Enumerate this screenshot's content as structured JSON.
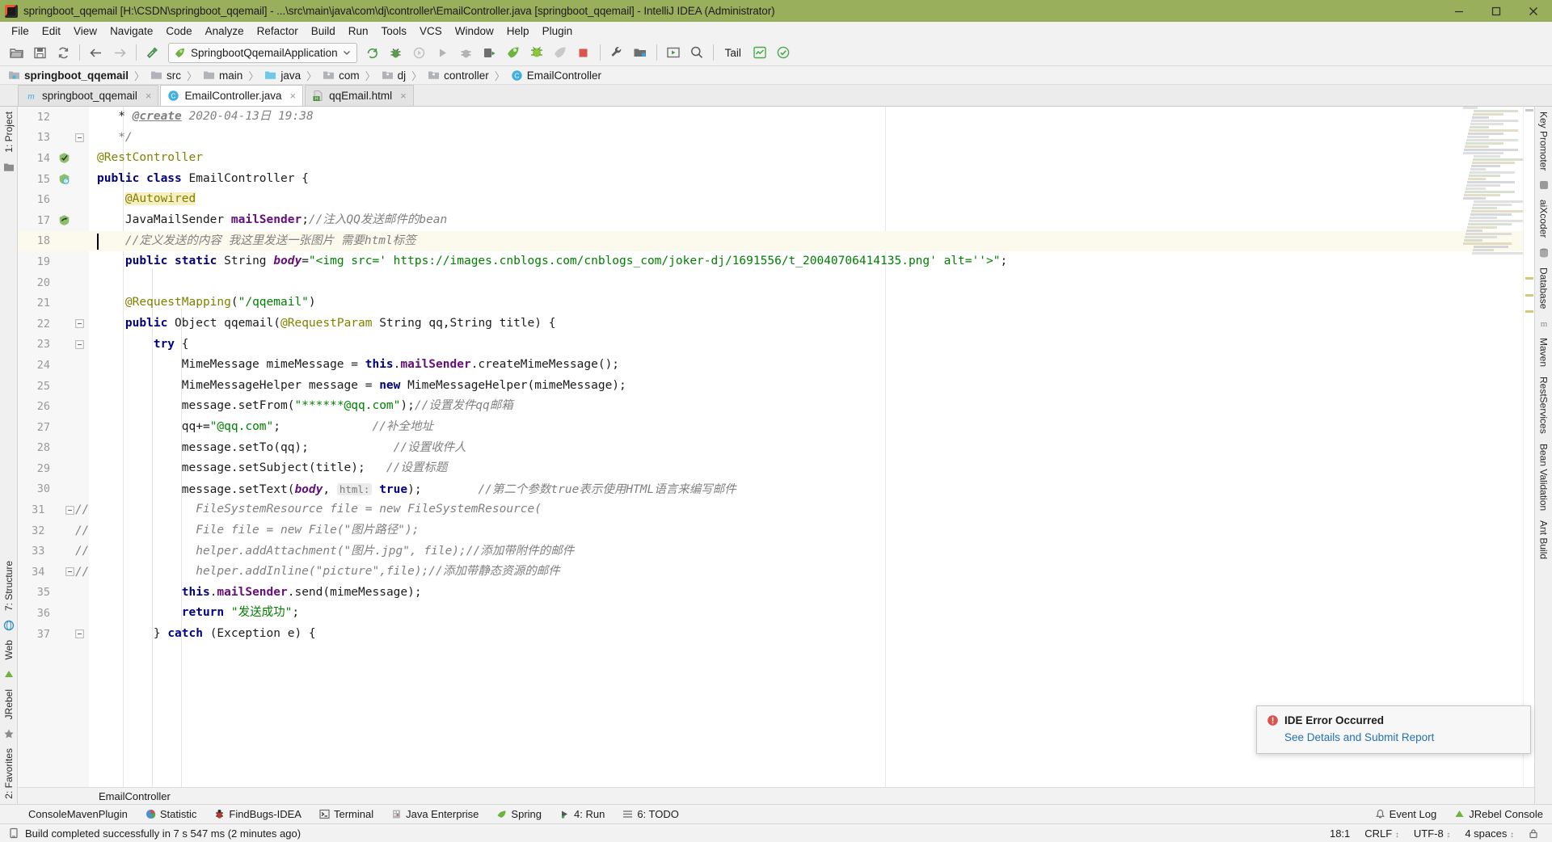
{
  "window": {
    "title": "springboot_qqemail [H:\\CSDN\\springboot_qqemail] - ...\\src\\main\\java\\com\\dj\\controller\\EmailController.java [springboot_qqemail] - IntelliJ IDEA (Administrator)",
    "icon": "intellij-idea-icon",
    "titlebar_color": "#9aaf5c",
    "minimize": "minimize-button",
    "maximize": "maximize-button",
    "close": "close-button"
  },
  "menubar": {
    "items": [
      {
        "label": "File"
      },
      {
        "label": "Edit"
      },
      {
        "label": "View"
      },
      {
        "label": "Navigate"
      },
      {
        "label": "Code"
      },
      {
        "label": "Analyze"
      },
      {
        "label": "Refactor"
      },
      {
        "label": "Build"
      },
      {
        "label": "Run"
      },
      {
        "label": "Tools"
      },
      {
        "label": "VCS"
      },
      {
        "label": "Window"
      },
      {
        "label": "Help"
      },
      {
        "label": "Plugin"
      }
    ]
  },
  "toolbar": {
    "run_config": "SpringbootQqemailApplication",
    "tail_label": "Tail",
    "icons": [
      "open-folder-icon",
      "save-all-icon",
      "sync-refresh-icon",
      "back-arrow-icon",
      "forward-arrow-icon",
      "build-hammer-icon",
      "rerun-icon",
      "debug-bug-icon",
      "run-with-coverage-icon",
      "run-icon",
      "attach-debugger-icon",
      "profile-icon",
      "spring-boot-run-icon",
      "spring-boot-debug-icon",
      "spring-boot-run-dashboard-icon",
      "stop-icon",
      "settings-wrench-icon",
      "project-structure-icon",
      "update-project-icon",
      "search-everywhere-icon",
      "tail-icon",
      "plugin-chart-icon",
      "check-circle-icon"
    ]
  },
  "breadcrumb": {
    "items": [
      {
        "label": "springboot_qqemail",
        "icon": "module-icon"
      },
      {
        "label": "src",
        "icon": "folder-icon"
      },
      {
        "label": "main",
        "icon": "folder-icon"
      },
      {
        "label": "java",
        "icon": "source-root-icon"
      },
      {
        "label": "com",
        "icon": "package-icon"
      },
      {
        "label": "dj",
        "icon": "package-icon"
      },
      {
        "label": "controller",
        "icon": "package-icon"
      },
      {
        "label": "EmailController",
        "icon": "class-icon"
      }
    ],
    "separator": "〉"
  },
  "tabs": [
    {
      "label": "springboot_qqemail",
      "icon": "maven-module-icon",
      "active": false,
      "close": "×"
    },
    {
      "label": "EmailController.java",
      "icon": "java-class-icon",
      "active": true,
      "close": "×"
    },
    {
      "label": "qqEmail.html",
      "icon": "html-file-icon",
      "active": false,
      "close": "×"
    }
  ],
  "left_strip": {
    "top": [
      {
        "label": "1: Project",
        "icon": "project-tool-icon"
      }
    ],
    "bottom": [
      {
        "label": "2: Favorites",
        "icon": "favorites-icon"
      },
      {
        "label": "JRebel",
        "icon": "jrebel-icon"
      },
      {
        "label": "Web",
        "icon": "web-icon"
      },
      {
        "label": "7: Structure",
        "icon": "structure-icon"
      }
    ]
  },
  "right_strip": {
    "items": [
      {
        "label": "Key Promoter",
        "icon": "key-promoter-icon"
      },
      {
        "label": "aiXcoder",
        "icon": "aixcoder-icon"
      },
      {
        "label": "Database",
        "icon": "database-icon"
      },
      {
        "label": "Maven",
        "icon": "maven-icon"
      },
      {
        "label": "RestServices",
        "icon": "rest-services-icon"
      },
      {
        "label": "Bean Validation",
        "icon": "bean-validation-icon"
      },
      {
        "label": "Ant Build",
        "icon": "ant-build-icon"
      }
    ]
  },
  "editor": {
    "first_line": 12,
    "caret_line": 18,
    "breadcrumb": "EmailController",
    "lines": [
      {
        "num": "12",
        "hl": false,
        "gutter_icon": "",
        "fold": "",
        "html": "   * <span class='cmt-u'>@create</span> <span class='cmt'>2020-04-13日 19:38</span>"
      },
      {
        "num": "13",
        "hl": false,
        "gutter_icon": "",
        "fold": "minus",
        "html": "   <span class='cmt'>*/</span>"
      },
      {
        "num": "14",
        "hl": false,
        "gutter_icon": "bean-check-icon",
        "fold": "",
        "html": "<span class='ann'>@RestController</span>"
      },
      {
        "num": "15",
        "hl": false,
        "gutter_icon": "spring-bean-icon",
        "fold": "",
        "html": "<span class='kw'>public class</span> EmailController {"
      },
      {
        "num": "16",
        "hl": false,
        "gutter_icon": "",
        "fold": "",
        "html": "    <span class='ann-hl'>@Autowired</span>"
      },
      {
        "num": "17",
        "hl": false,
        "gutter_icon": "autowired-icon",
        "fold": "",
        "html": "    JavaMailSender <span class='fldp'>mailSender</span>;<span class='cmt'>//注入QQ发送邮件的bean</span>"
      },
      {
        "num": "18",
        "hl": true,
        "gutter_icon": "",
        "fold": "",
        "html": "    <span class='cmt'>//定义发送的内容 我这里发送一张图片 需要html标签</span>"
      },
      {
        "num": "19",
        "hl": false,
        "gutter_icon": "",
        "fold": "",
        "html": "    <span class='kw'>public static</span> String <span class='fld'>body</span>=<span class='str'>\"&lt;img src=' https://images.cnblogs.com/cnblogs_com/joker-dj/1691556/t_20040706414135.png' alt=''&gt;\"</span>;"
      },
      {
        "num": "20",
        "hl": false,
        "gutter_icon": "",
        "fold": "",
        "html": ""
      },
      {
        "num": "21",
        "hl": false,
        "gutter_icon": "",
        "fold": "",
        "html": "    <span class='ann'>@RequestMapping</span>(<span class='str'>\"/qqemail\"</span>)"
      },
      {
        "num": "22",
        "hl": false,
        "gutter_icon": "",
        "fold": "minus",
        "html": "    <span class='kw'>public</span> Object qqemail(<span class='ann'>@RequestParam</span> String qq,String title) {"
      },
      {
        "num": "23",
        "hl": false,
        "gutter_icon": "",
        "fold": "minus",
        "html": "        <span class='kw'>try</span> {"
      },
      {
        "num": "24",
        "hl": false,
        "gutter_icon": "",
        "fold": "",
        "html": "            MimeMessage mimeMessage = <span class='kw'>this</span>.<span class='fldp'>mailSender</span>.createMimeMessage();"
      },
      {
        "num": "25",
        "hl": false,
        "gutter_icon": "",
        "fold": "",
        "html": "            MimeMessageHelper message = <span class='kw'>new</span> MimeMessageHelper(mimeMessage);"
      },
      {
        "num": "26",
        "hl": false,
        "gutter_icon": "",
        "fold": "",
        "html": "            message.setFrom(<span class='str'>\"******@qq.com\"</span>);<span class='cmt'>//设置发件qq邮箱</span>"
      },
      {
        "num": "27",
        "hl": false,
        "gutter_icon": "",
        "fold": "",
        "html": "            qq+=<span class='str'>\"@qq.com\"</span>;             <span class='cmt'>//补全地址</span>"
      },
      {
        "num": "28",
        "hl": false,
        "gutter_icon": "",
        "fold": "",
        "html": "            message.setTo(qq);            <span class='cmt'>//设置收件人</span>"
      },
      {
        "num": "29",
        "hl": false,
        "gutter_icon": "",
        "fold": "",
        "html": "            message.setSubject(title);   <span class='cmt'>//设置标题</span>"
      },
      {
        "num": "30",
        "hl": false,
        "gutter_icon": "",
        "fold": "",
        "html": "            message.setText(<span class='fld'>body</span>, <span class='param-hint'>html:</span> <span class='kw'>true</span>);        <span class='cmt'>//第二个参数true表示使用HTML语言来编写邮件</span>"
      },
      {
        "num": "31",
        "hl": false,
        "gutter_icon": "",
        "fold": "minus-comment",
        "html": "              <span class='cmt'>FileSystemResource file = new FileSystemResource(</span>"
      },
      {
        "num": "32",
        "hl": false,
        "gutter_icon": "",
        "fold": "comment",
        "html": "              <span class='cmt'>File file = new File(\"图片路径\");</span>"
      },
      {
        "num": "33",
        "hl": false,
        "gutter_icon": "",
        "fold": "comment",
        "html": "              <span class='cmt'>helper.addAttachment(\"图片.jpg\", file);//添加带附件的邮件</span>"
      },
      {
        "num": "34",
        "hl": false,
        "gutter_icon": "",
        "fold": "minus-comment",
        "html": "              <span class='cmt'>helper.addInline(\"picture\",file);//添加带静态资源的邮件</span>"
      },
      {
        "num": "35",
        "hl": false,
        "gutter_icon": "",
        "fold": "",
        "html": "            <span class='kw'>this</span>.<span class='fldp'>mailSender</span>.send(mimeMessage);"
      },
      {
        "num": "36",
        "hl": false,
        "gutter_icon": "",
        "fold": "",
        "html": "            <span class='kw'>return</span> <span class='str'>\"发送成功\"</span>;"
      },
      {
        "num": "37",
        "hl": false,
        "gutter_icon": "",
        "fold": "minus",
        "html": "        } <span class='kw'>catch</span> (Exception e) {"
      }
    ]
  },
  "notification": {
    "icon": "error-icon",
    "title": "IDE Error Occurred",
    "link": "See Details and Submit Report"
  },
  "bottom_bar": {
    "items": [
      {
        "label": "ConsoleMavenPlugin",
        "icon": ""
      },
      {
        "label": "Statistic",
        "icon": "statistic-icon"
      },
      {
        "label": "FindBugs-IDEA",
        "icon": "findbugs-icon"
      },
      {
        "label": "Terminal",
        "icon": "terminal-icon"
      },
      {
        "label": "Java Enterprise",
        "icon": "java-enterprise-icon"
      },
      {
        "label": "Spring",
        "icon": "spring-leaf-icon"
      },
      {
        "label": "4: Run",
        "icon": "run-icon"
      },
      {
        "label": "6: TODO",
        "icon": "todo-icon"
      }
    ],
    "right": [
      {
        "label": "Event Log",
        "icon": "event-log-icon"
      },
      {
        "label": "JRebel Console",
        "icon": "jrebel-console-icon"
      }
    ]
  },
  "statusbar": {
    "message": "Build completed successfully in 7 s 547 ms (2 minutes ago)",
    "message_icon": "build-icon",
    "position": "18:1",
    "line_separator": "CRLF",
    "encoding": "UTF-8",
    "indent": "4 spaces",
    "lock_icon": "lock-icon"
  }
}
